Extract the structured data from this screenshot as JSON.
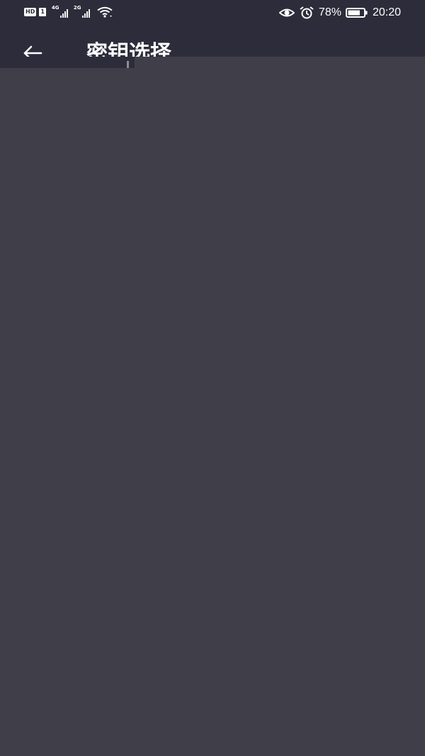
{
  "status_bar": {
    "hd_label": "HD",
    "sim_label": "1",
    "signal_1_gen": "4G",
    "signal_2_gen": "2G",
    "battery_percent": "78%",
    "battery_level": 0.78,
    "time": "20:20",
    "icons": [
      "hd-icon",
      "signal-icon",
      "wifi-icon",
      "eye-icon",
      "alarm-icon",
      "battery-icon"
    ]
  },
  "app_bar": {
    "back_icon": "arrow-left-icon",
    "title": "密钥选择"
  },
  "colors": {
    "header_bg": "#2d2c3a",
    "content_bg": "#403f49",
    "text": "#ffffff"
  }
}
